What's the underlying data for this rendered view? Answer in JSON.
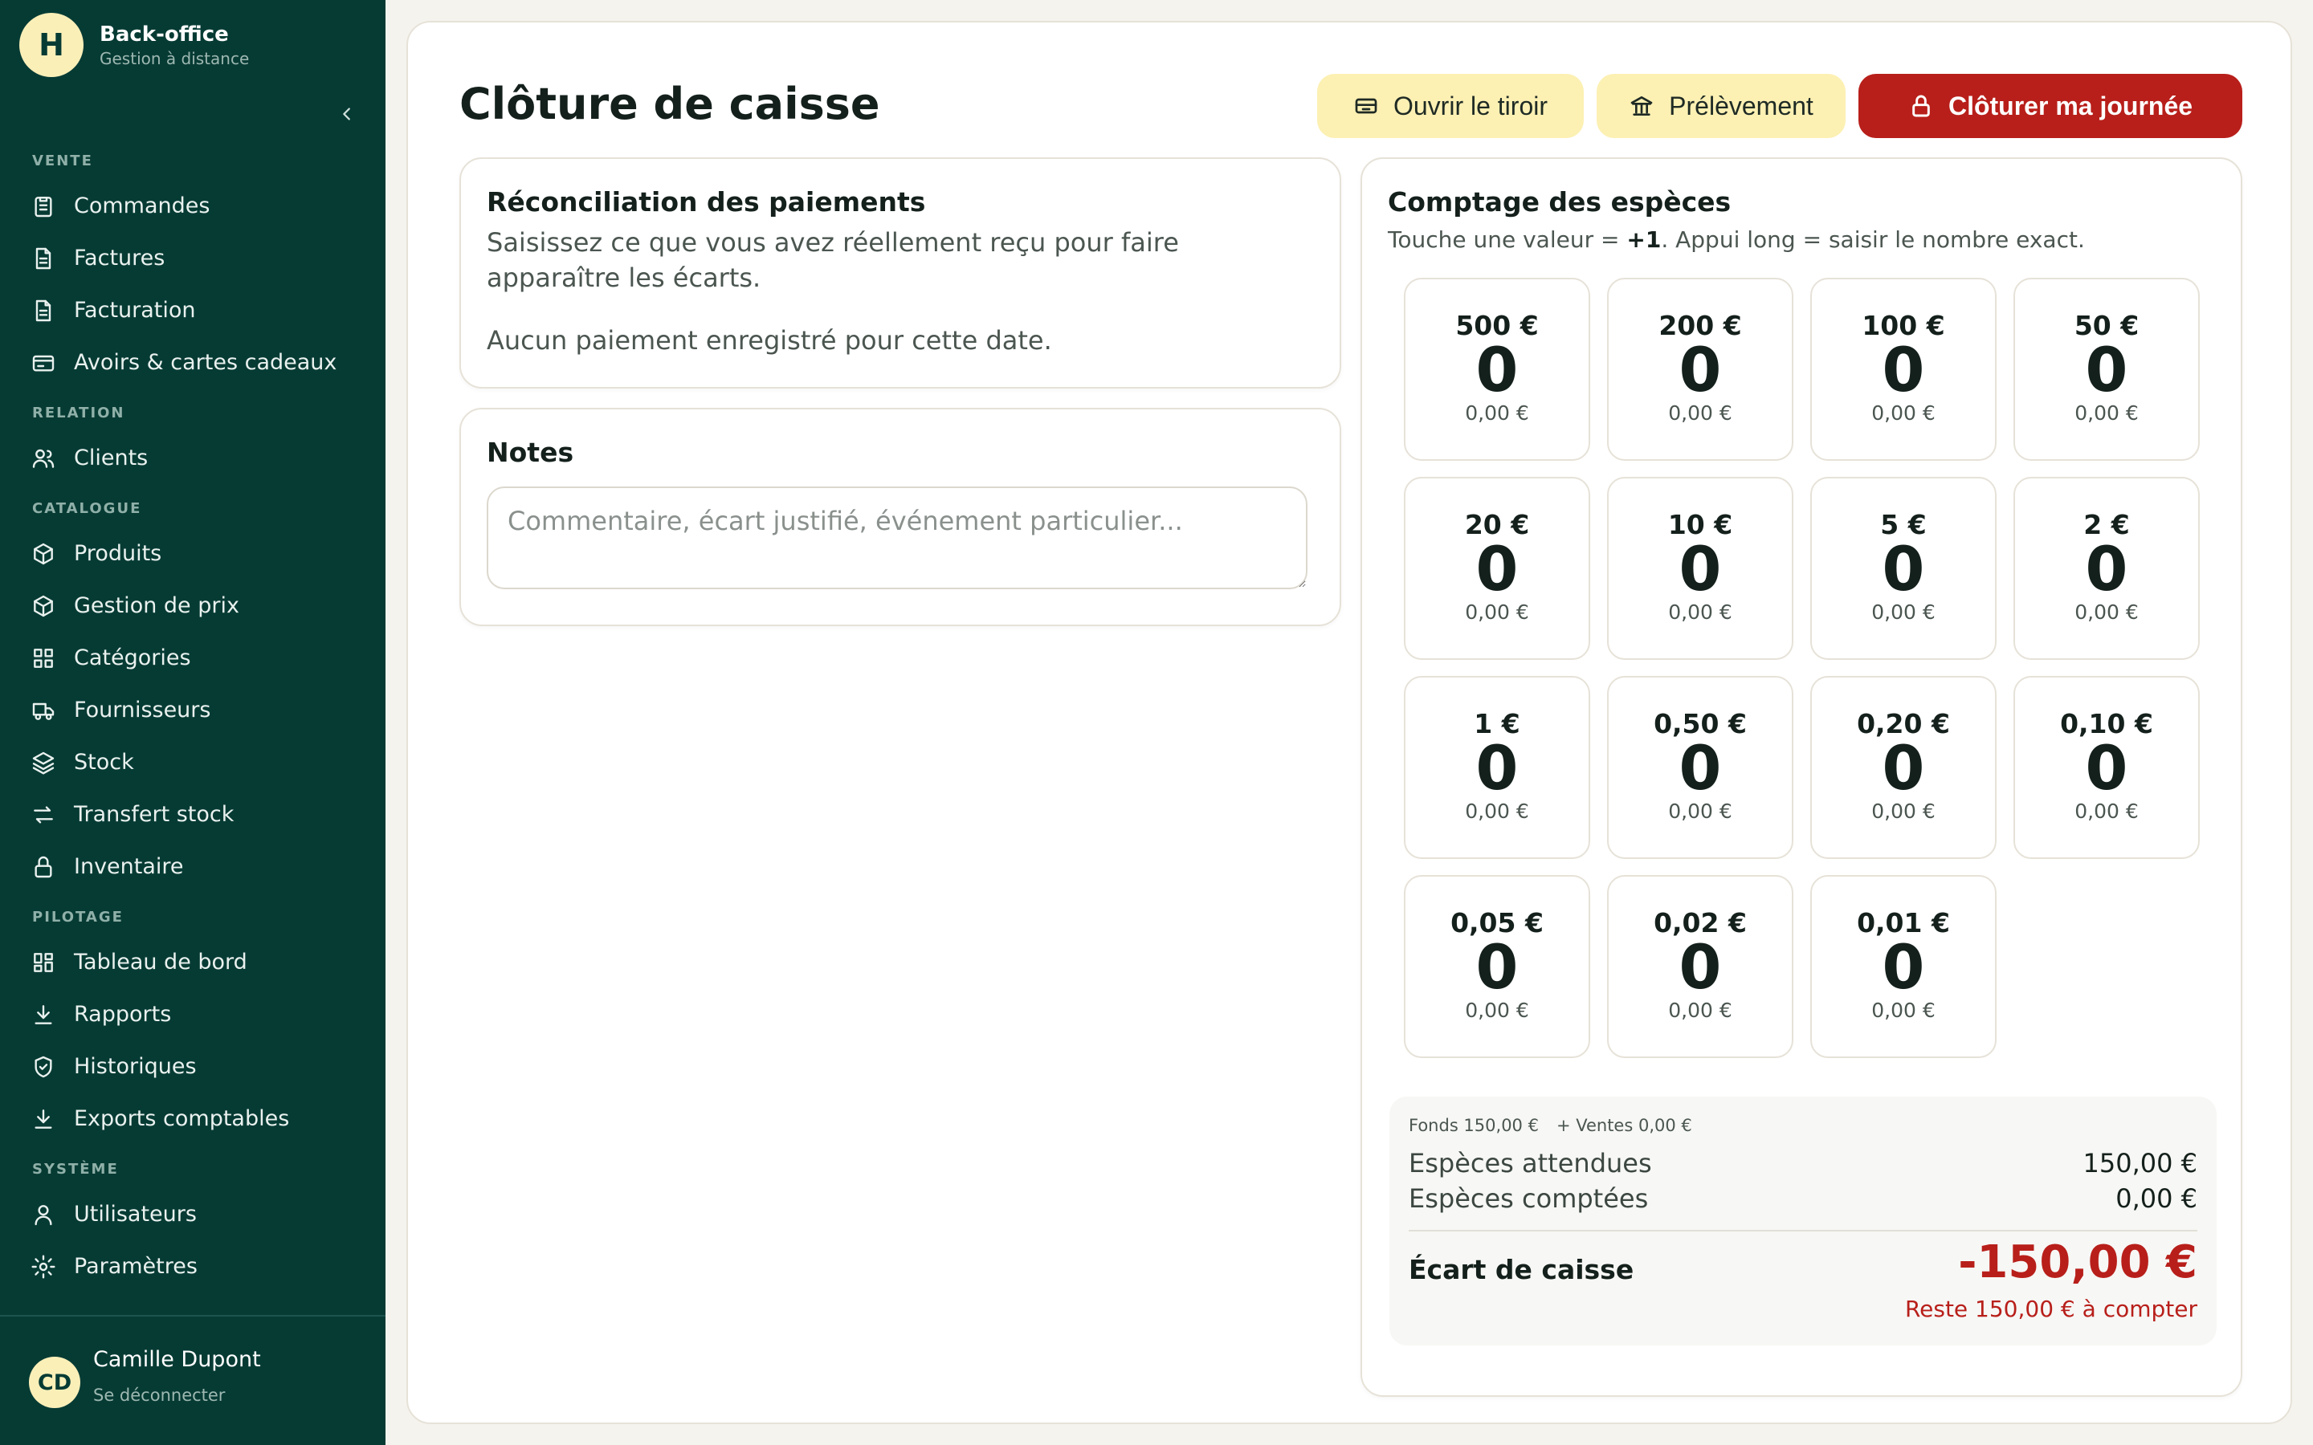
{
  "brand": {
    "logo_letter": "H",
    "title": "Back-office",
    "subtitle": "Gestion à distance"
  },
  "sidebar": {
    "sections": [
      {
        "label": "VENTE",
        "items": [
          {
            "label": "Commandes",
            "icon": "clipboard-icon"
          },
          {
            "label": "Factures",
            "icon": "document-icon"
          },
          {
            "label": "Facturation",
            "icon": "document-icon"
          },
          {
            "label": "Avoirs & cartes cadeaux",
            "icon": "card-icon"
          }
        ]
      },
      {
        "label": "RELATION",
        "items": [
          {
            "label": "Clients",
            "icon": "users-icon"
          }
        ]
      },
      {
        "label": "CATALOGUE",
        "items": [
          {
            "label": "Produits",
            "icon": "box-icon"
          },
          {
            "label": "Gestion de prix",
            "icon": "box-icon"
          },
          {
            "label": "Catégories",
            "icon": "grid-icon"
          },
          {
            "label": "Fournisseurs",
            "icon": "truck-icon"
          },
          {
            "label": "Stock",
            "icon": "layers-icon"
          },
          {
            "label": "Transfert stock",
            "icon": "transfer-icon"
          },
          {
            "label": "Inventaire",
            "icon": "lock-icon"
          }
        ]
      },
      {
        "label": "PILOTAGE",
        "items": [
          {
            "label": "Tableau de bord",
            "icon": "dashboard-icon"
          },
          {
            "label": "Rapports",
            "icon": "download-icon"
          },
          {
            "label": "Historiques",
            "icon": "shield-icon"
          },
          {
            "label": "Exports comptables",
            "icon": "download-icon"
          }
        ]
      },
      {
        "label": "SYSTÈME",
        "items": [
          {
            "label": "Utilisateurs",
            "icon": "user-icon"
          },
          {
            "label": "Paramètres",
            "icon": "gear-icon"
          }
        ]
      }
    ]
  },
  "user": {
    "initials": "CD",
    "name": "Camille Dupont",
    "logout": "Se déconnecter"
  },
  "page": {
    "title": "Clôture de caisse"
  },
  "toolbar": {
    "open_drawer": "Ouvrir le tiroir",
    "withdrawal": "Prélèvement",
    "close_day": "Clôturer ma journée"
  },
  "reconciliation": {
    "title": "Réconciliation des paiements",
    "description": "Saisissez ce que vous avez réellement reçu pour faire apparaître les écarts.",
    "empty": "Aucun paiement enregistré pour cette date."
  },
  "notes": {
    "title": "Notes",
    "placeholder": "Commentaire, écart justifié, événement particulier..."
  },
  "cash_count": {
    "title": "Comptage des espèces",
    "hint_prefix": "Touche une valeur = ",
    "hint_bold": "+1",
    "hint_suffix": ". Appui long = saisir le nombre exact.",
    "denominations": [
      {
        "label": "500 €",
        "count": "0",
        "total": "0,00 €"
      },
      {
        "label": "200 €",
        "count": "0",
        "total": "0,00 €"
      },
      {
        "label": "100 €",
        "count": "0",
        "total": "0,00 €"
      },
      {
        "label": "50 €",
        "count": "0",
        "total": "0,00 €"
      },
      {
        "label": "20 €",
        "count": "0",
        "total": "0,00 €"
      },
      {
        "label": "10 €",
        "count": "0",
        "total": "0,00 €"
      },
      {
        "label": "5 €",
        "count": "0",
        "total": "0,00 €"
      },
      {
        "label": "2 €",
        "count": "0",
        "total": "0,00 €"
      },
      {
        "label": "1 €",
        "count": "0",
        "total": "0,00 €"
      },
      {
        "label": "0,50 €",
        "count": "0",
        "total": "0,00 €"
      },
      {
        "label": "0,20 €",
        "count": "0",
        "total": "0,00 €"
      },
      {
        "label": "0,10 €",
        "count": "0",
        "total": "0,00 €"
      },
      {
        "label": "0,05 €",
        "count": "0",
        "total": "0,00 €"
      },
      {
        "label": "0,02 €",
        "count": "0",
        "total": "0,00 €"
      },
      {
        "label": "0,01 €",
        "count": "0",
        "total": "0,00 €"
      }
    ]
  },
  "summary": {
    "fonds": "Fonds 150,00 €",
    "ventes": "+ Ventes 0,00 €",
    "expected_label": "Espèces attendues",
    "expected_value": "150,00 €",
    "counted_label": "Espèces comptées",
    "counted_value": "0,00 €",
    "ecart_label": "Écart de caisse",
    "ecart_value": "-150,00 €",
    "rest": "Reste 150,00 € à compter"
  },
  "colors": {
    "sidebar": "#063b34",
    "accent_yellow": "#fcf0b3",
    "danger": "#b81f1a"
  }
}
